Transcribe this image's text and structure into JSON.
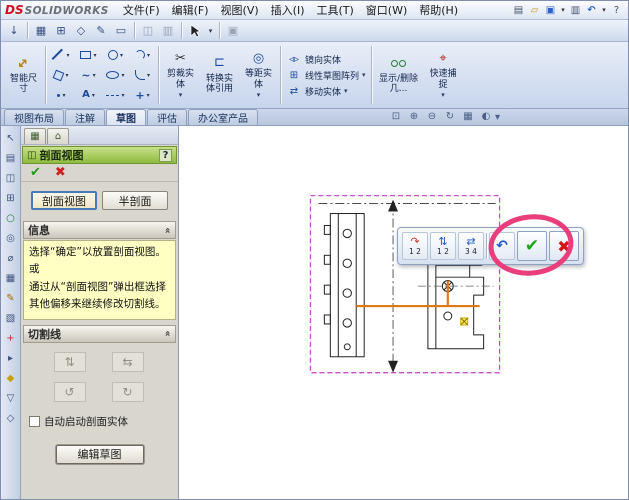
{
  "titlebar": {
    "logo_ds": "DS",
    "logo_text": "SOLIDWORKS",
    "menus": [
      "文件(F)",
      "编辑(F)",
      "视图(V)",
      "插入(I)",
      "工具(T)",
      "窗口(W)",
      "帮助(H)"
    ]
  },
  "icons": {
    "dropdown": "▾",
    "check": "✔",
    "cross": "✖",
    "undo": "↶",
    "help": "?",
    "chevron": "»",
    "new_doc": "▤",
    "open_folder": "▱",
    "save": "▣",
    "print": "▥",
    "down_arrow": "↓",
    "text_tool": "A",
    "scissors": "✂",
    "offset": "◎",
    "convert": "⊏",
    "mirror": "◃▹",
    "pattern": "⊞",
    "move": "⇄",
    "snap": "⌖",
    "dim": "↔",
    "pm_tab1": "▦",
    "pm_tab2": "⌂",
    "title_icon": "◫"
  },
  "toolbar2": {
    "icons": [
      "↓",
      "▦",
      "⊞",
      "◇",
      "✎",
      "▭",
      "◫",
      "▥",
      "▣"
    ]
  },
  "sketch_toolbar": {
    "smart_dimension": "智能尺寸",
    "trim": "剪裁实体",
    "convert": "转换实体引用",
    "offset": "等距实体",
    "mirror": "镜向实体",
    "linear_pattern": "线性草图阵列",
    "move": "移动实体",
    "display_delete": "显示/删除几...",
    "quick_snap": "快速捕捉"
  },
  "tabs": {
    "items": [
      "视图布局",
      "注解",
      "草图",
      "评估",
      "办公室产品"
    ],
    "active": "草图"
  },
  "view_icons": [
    "⊡",
    "⊕",
    "⊖",
    "↻",
    "▦",
    "◐"
  ],
  "side_icons": [
    "↖",
    "▤",
    "◫",
    "⊞",
    "○",
    "◎",
    "⌀",
    "▦",
    "✎",
    "▧",
    "+",
    "▸",
    "◆",
    "▽",
    "◇"
  ],
  "property_manager": {
    "title": "剖面视图",
    "help": "?",
    "mode_full": "剖面视图",
    "mode_half": "半剖面",
    "info_header": "信息",
    "message_lines": [
      "选择“确定”以放置剖面视图。",
      "或",
      "通过从“剖面视图”弹出框选择",
      "其他偏移来继续修改切割线。"
    ],
    "cutting_header": "切割线",
    "cutting_icons": [
      "⇅",
      "⇆",
      "↺",
      "↻"
    ],
    "auto_start": "自动启动剖面实体",
    "edit_sketch": "编辑草图"
  },
  "popup": {
    "flips": [
      {
        "glyph": "↷",
        "nums": "1 2"
      },
      {
        "glyph": "⇅",
        "nums": "1 2"
      },
      {
        "glyph": "⇄",
        "nums": "3 4"
      }
    ]
  }
}
